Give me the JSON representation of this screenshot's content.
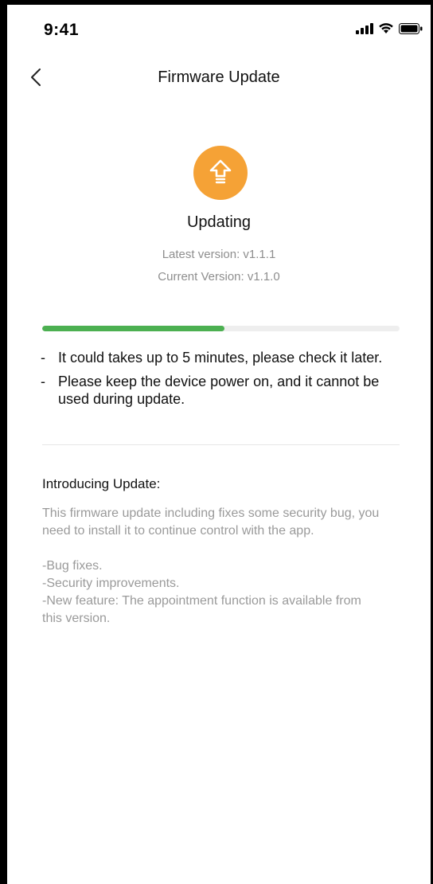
{
  "status_bar": {
    "time": "9:41"
  },
  "nav": {
    "title": "Firmware Update",
    "back_icon": "chevron-left-icon"
  },
  "update": {
    "icon": "upload-arrow-icon",
    "icon_color": "#f5a236",
    "status": "Updating",
    "latest_version": "Latest version: v1.1.1",
    "current_version": "Current Version: v1.1.0",
    "progress_percent": 51,
    "progress_color": "#4cb051",
    "track_color": "#eeeeee"
  },
  "notes": [
    {
      "dash": "-",
      "text": "It could takes up to 5 minutes, please check it later."
    },
    {
      "dash": "-",
      "text": "Please keep the device power on, and it cannot be used during update."
    }
  ],
  "intro": {
    "heading": "Introducing Update:",
    "paragraph": "This firmware update including fixes some security bug, you need to install it to continue control with the app.",
    "items": [
      "-Bug fixes.",
      "-Security improvements.",
      "-New feature: The appointment function is available from this version."
    ]
  }
}
